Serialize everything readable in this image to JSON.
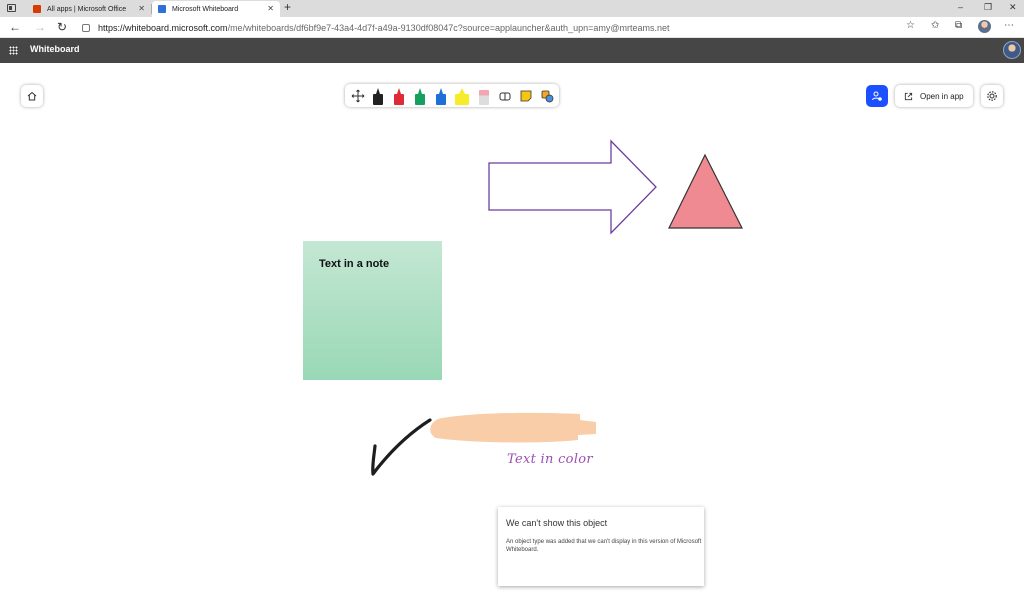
{
  "browser": {
    "tabs": [
      {
        "label": "All apps | Microsoft Office",
        "active": false
      },
      {
        "label": "Microsoft Whiteboard",
        "active": true
      }
    ],
    "url_host": "https://whiteboard.microsoft.com",
    "url_path": "/me/whiteboards/df6bf9e7-43a4-4d7f-a49a-9130df08047c?source=applauncher&auth_upn=amy@mrteams.net",
    "new_tab_glyph": "+",
    "window_controls": [
      "–",
      "❐",
      "✕"
    ]
  },
  "app": {
    "title": "Whiteboard"
  },
  "toolbar": {
    "open_in_app_label": "Open in app",
    "pens": [
      {
        "name": "black-pen",
        "color": "#222222"
      },
      {
        "name": "red-pen",
        "color": "#e02a35"
      },
      {
        "name": "green-pen",
        "color": "#17a05d"
      },
      {
        "name": "blue-pen",
        "color": "#1e6fd9"
      },
      {
        "name": "yellow-highlighter",
        "color": "#f6ec2a"
      },
      {
        "name": "eraser",
        "color": "#f2a6b3"
      }
    ]
  },
  "canvas": {
    "sticky_note_text": "Text in a note",
    "colored_text": "Text in color",
    "arrow_stroke": "#6b3fa0",
    "triangle_fill": "#f08a92",
    "highlight_stroke": "#f9cda8",
    "error_card": {
      "title": "We can't show this object",
      "message": "An object type was added that we can't display in this version of Microsoft Whiteboard."
    }
  }
}
